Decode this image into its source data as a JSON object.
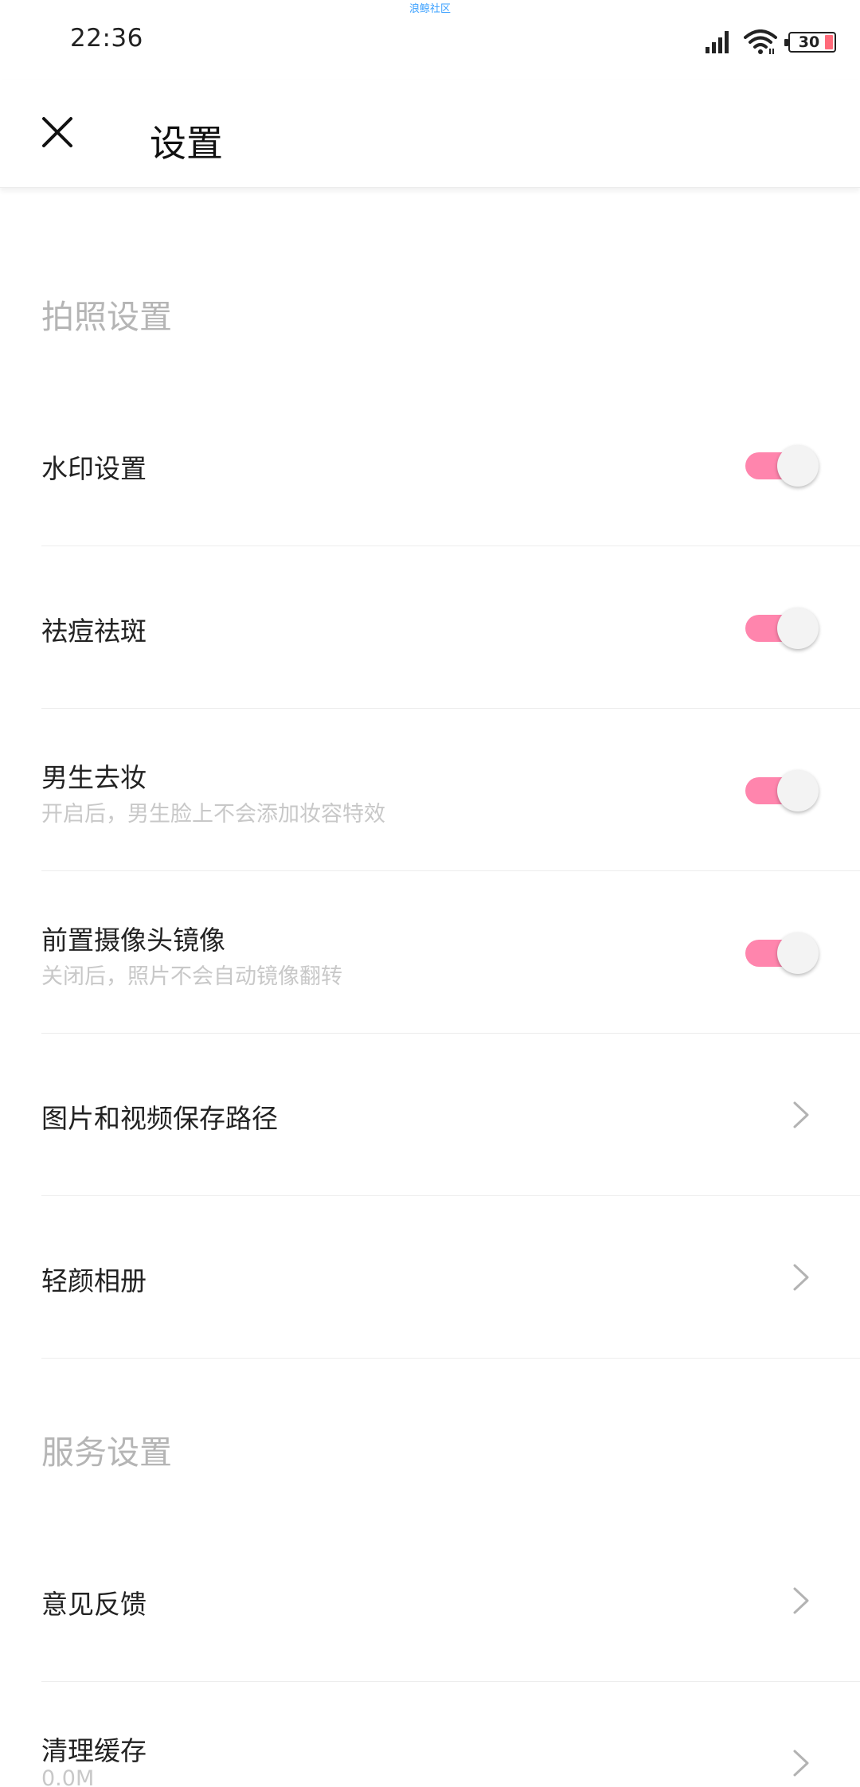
{
  "status_bar": {
    "time": "22:36",
    "watermark": "浪鲸社区",
    "battery": "30",
    "icons": [
      "signal-icon",
      "wifi-icon",
      "battery-icon"
    ]
  },
  "header": {
    "title": "设置",
    "close_icon": "close-icon"
  },
  "sections": [
    {
      "title": "拍照设置",
      "items": [
        {
          "label": "水印设置",
          "control": "toggle",
          "on": true
        },
        {
          "label": "祛痘祛斑",
          "control": "toggle",
          "on": true
        },
        {
          "label": "男生去妆",
          "subtitle": "开启后，男生脸上不会添加妆容特效",
          "control": "toggle",
          "on": true
        },
        {
          "label": "前置摄像头镜像",
          "subtitle": "关闭后，照片不会自动镜像翻转",
          "control": "toggle",
          "on": true
        },
        {
          "label": "图片和视频保存路径",
          "control": "chevron"
        },
        {
          "label": "轻颜相册",
          "control": "chevron"
        }
      ]
    },
    {
      "title": "服务设置",
      "items": [
        {
          "label": "意见反馈",
          "control": "chevron"
        },
        {
          "label": "清理缓存",
          "subtitle": "0.0M",
          "control": "chevron"
        }
      ]
    }
  ],
  "colors": {
    "toggle_on": "#ff85ad",
    "section_title": "#b5b5b5",
    "subtitle": "#c8c8c8"
  }
}
